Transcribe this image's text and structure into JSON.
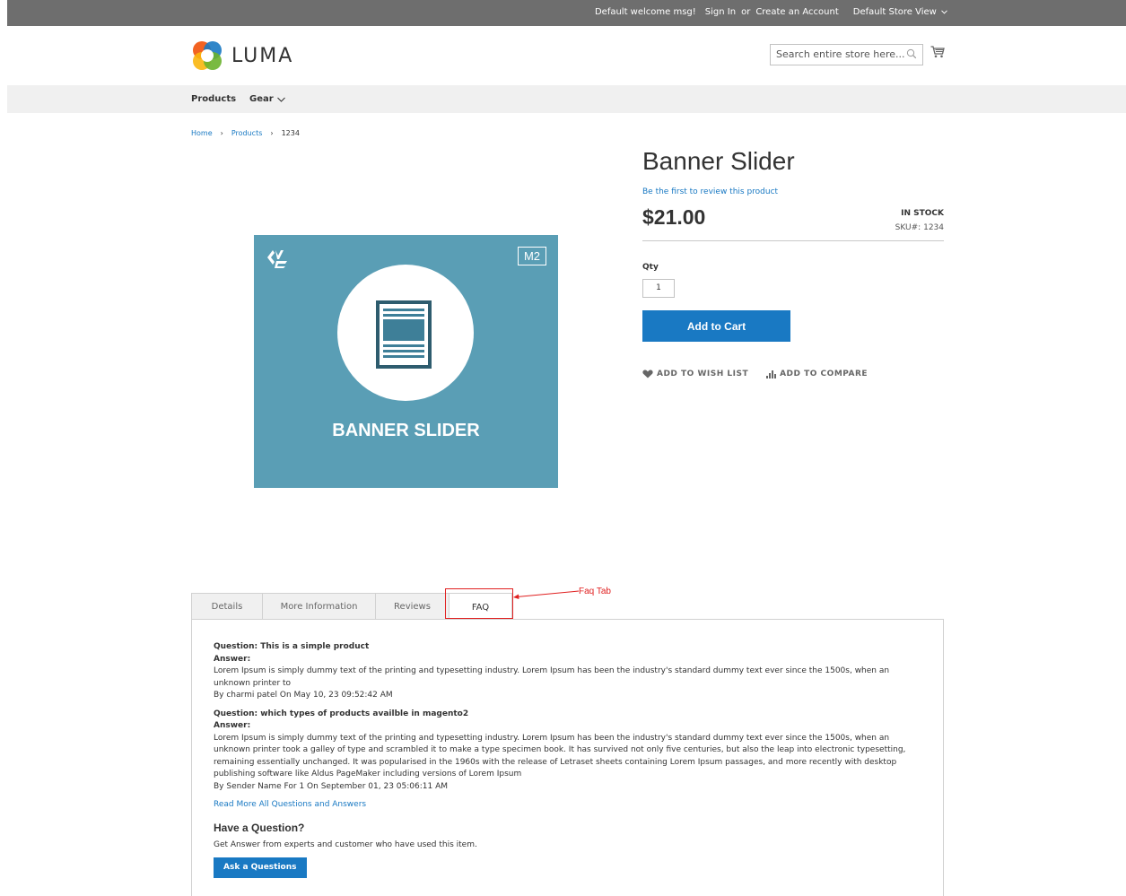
{
  "topbar": {
    "welcome": "Default welcome msg!",
    "sign_in": "Sign In",
    "or": "or",
    "create_account": "Create an Account",
    "store_view": "Default Store View"
  },
  "header": {
    "logo_text": "LUMA",
    "search_placeholder": "Search entire store here..."
  },
  "nav": {
    "items": [
      {
        "label": "Products"
      },
      {
        "label": "Gear"
      }
    ]
  },
  "breadcrumb": {
    "home": "Home",
    "products": "Products",
    "current": "1234"
  },
  "image": {
    "badge": "M2",
    "caption": "BANNER SLIDER"
  },
  "product": {
    "title": "Banner Slider",
    "review_link": "Be the first to review this product",
    "price": "$21.00",
    "stock": "IN STOCK",
    "sku_label": "SKU#:",
    "sku": "1234",
    "qty_label": "Qty",
    "qty_value": "1",
    "add_to_cart": "Add to Cart",
    "wish_list": "ADD TO WISH LIST",
    "compare": "ADD TO COMPARE"
  },
  "tabs": [
    {
      "label": "Details"
    },
    {
      "label": "More Information"
    },
    {
      "label": "Reviews"
    },
    {
      "label": "FAQ"
    }
  ],
  "annotation": {
    "label": "Faq Tab",
    "color": "#e02020"
  },
  "faq": {
    "items": [
      {
        "question": "Question: This is a simple product",
        "answer_label": "Answer:",
        "answer": "Lorem Ipsum is simply dummy text of the printing and typesetting industry. Lorem Ipsum has been the industry's standard dummy text ever since the 1500s, when an unknown printer to",
        "byline": "By charmi patel On May 10, 23 09:52:42 AM"
      },
      {
        "question": "Question: which types of products availble in magento2",
        "answer_label": "Answer:",
        "answer": "Lorem Ipsum is simply dummy text of the printing and typesetting industry. Lorem Ipsum has been the industry's standard dummy text ever since the 1500s, when an unknown printer took a galley of type and scrambled it to make a type specimen book. It has survived not only five centuries, but also the leap into electronic typesetting, remaining essentially unchanged. It was popularised in the 1960s with the release of Letraset sheets containing Lorem Ipsum passages, and more recently with desktop publishing software like Aldus PageMaker including versions of Lorem Ipsum",
        "byline": "By Sender Name For 1 On September 01, 23 05:06:11 AM"
      }
    ],
    "read_more": "Read More All Questions and Answers",
    "have_question": "Have a Question?",
    "have_question_sub": "Get Answer from experts and customer who have used this item.",
    "ask_button": "Ask a Questions"
  },
  "colors": {
    "accent": "#1979c3",
    "image_bg": "#5a9eb5",
    "topbar": "#6e6e6e"
  }
}
